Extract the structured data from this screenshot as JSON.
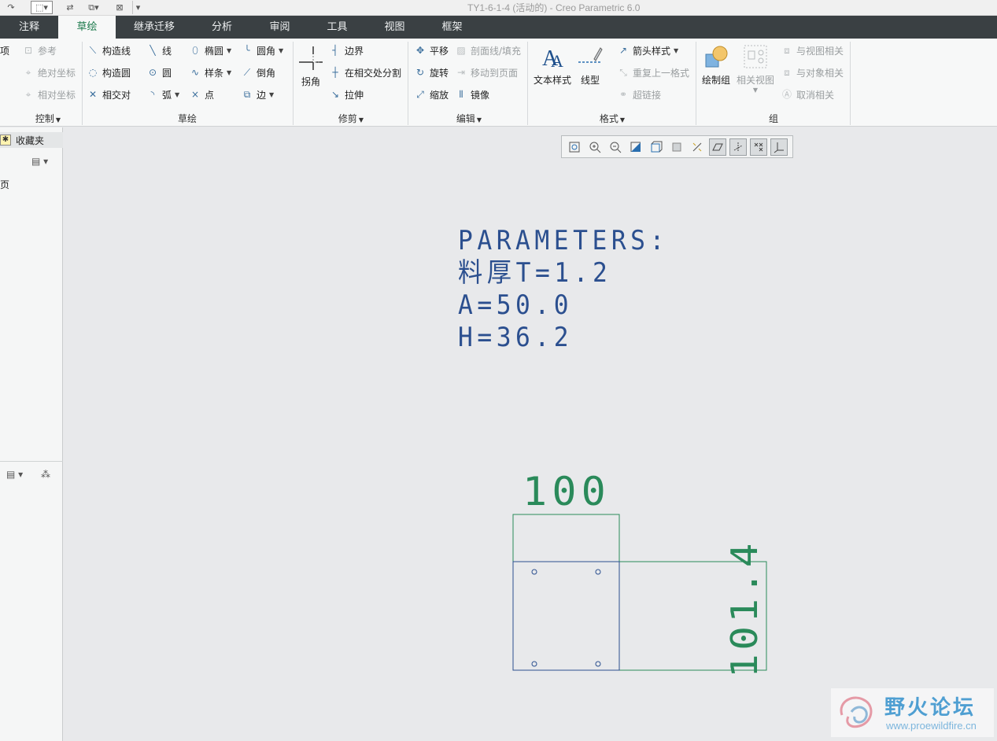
{
  "window": {
    "title": "TY1-6-1-4 (活动的) - Creo Parametric 6.0"
  },
  "tabs": [
    {
      "label": "注释",
      "active": false
    },
    {
      "label": "草绘",
      "active": true
    },
    {
      "label": "继承迁移",
      "active": false
    },
    {
      "label": "分析",
      "active": false
    },
    {
      "label": "审阅",
      "active": false
    },
    {
      "label": "工具",
      "active": false
    },
    {
      "label": "视图",
      "active": false
    },
    {
      "label": "框架",
      "active": false
    }
  ],
  "ribbon": {
    "control": {
      "label": "控制",
      "items": [
        "项",
        "参考",
        "绝对坐标",
        "相对坐标"
      ]
    },
    "sketch": {
      "label": "草绘",
      "items": [
        "构造线",
        "构造圆",
        "相交对",
        "线",
        "圆",
        "弧",
        "椭圆",
        "样条",
        "点",
        "圆角",
        "倒角",
        "边"
      ]
    },
    "trim": {
      "label": "修剪",
      "corner": "拐角",
      "items": [
        "边界",
        "在相交处分割",
        "拉伸"
      ]
    },
    "edit": {
      "label": "编辑",
      "items": [
        "平移",
        "旋转",
        "缩放",
        "剖面线/填充",
        "移动到页面",
        "镜像"
      ]
    },
    "format": {
      "label": "格式",
      "text_style": "文本样式",
      "line_style": "线型",
      "items": [
        "箭头样式",
        "重复上一格式",
        "超链接"
      ]
    },
    "group": {
      "label": "组",
      "draw_group": "绘制组",
      "related_view": "相关视图",
      "items": [
        "与视图相关",
        "与对象相关",
        "取消相关"
      ]
    }
  },
  "left_panel": {
    "favorites": "收藏夹",
    "page": "页"
  },
  "canvas": {
    "parameters": [
      "PARAMETERS:",
      "料厚T=1.2",
      "A=50.0",
      "H=36.2"
    ],
    "dims": {
      "top": "100",
      "side": "101.4"
    }
  },
  "watermark": {
    "title": "野火论坛",
    "url": "www.proewildfire.cn"
  },
  "colors": {
    "tab_bar": "#3a4043",
    "active_tab_text": "#1c7a4c",
    "param_text": "#2b4f8f",
    "sketch_blue": "#2b4f8f",
    "sketch_green": "#2a8a5a"
  }
}
